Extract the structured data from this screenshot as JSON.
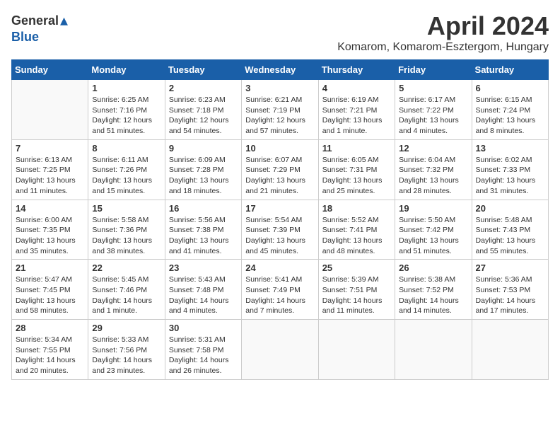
{
  "header": {
    "logo_general": "General",
    "logo_blue": "Blue",
    "month_title": "April 2024",
    "location": "Komarom, Komarom-Esztergom, Hungary"
  },
  "weekdays": [
    "Sunday",
    "Monday",
    "Tuesday",
    "Wednesday",
    "Thursday",
    "Friday",
    "Saturday"
  ],
  "weeks": [
    [
      {
        "day": "",
        "info": ""
      },
      {
        "day": "1",
        "info": "Sunrise: 6:25 AM\nSunset: 7:16 PM\nDaylight: 12 hours\nand 51 minutes."
      },
      {
        "day": "2",
        "info": "Sunrise: 6:23 AM\nSunset: 7:18 PM\nDaylight: 12 hours\nand 54 minutes."
      },
      {
        "day": "3",
        "info": "Sunrise: 6:21 AM\nSunset: 7:19 PM\nDaylight: 12 hours\nand 57 minutes."
      },
      {
        "day": "4",
        "info": "Sunrise: 6:19 AM\nSunset: 7:21 PM\nDaylight: 13 hours\nand 1 minute."
      },
      {
        "day": "5",
        "info": "Sunrise: 6:17 AM\nSunset: 7:22 PM\nDaylight: 13 hours\nand 4 minutes."
      },
      {
        "day": "6",
        "info": "Sunrise: 6:15 AM\nSunset: 7:24 PM\nDaylight: 13 hours\nand 8 minutes."
      }
    ],
    [
      {
        "day": "7",
        "info": "Sunrise: 6:13 AM\nSunset: 7:25 PM\nDaylight: 13 hours\nand 11 minutes."
      },
      {
        "day": "8",
        "info": "Sunrise: 6:11 AM\nSunset: 7:26 PM\nDaylight: 13 hours\nand 15 minutes."
      },
      {
        "day": "9",
        "info": "Sunrise: 6:09 AM\nSunset: 7:28 PM\nDaylight: 13 hours\nand 18 minutes."
      },
      {
        "day": "10",
        "info": "Sunrise: 6:07 AM\nSunset: 7:29 PM\nDaylight: 13 hours\nand 21 minutes."
      },
      {
        "day": "11",
        "info": "Sunrise: 6:05 AM\nSunset: 7:31 PM\nDaylight: 13 hours\nand 25 minutes."
      },
      {
        "day": "12",
        "info": "Sunrise: 6:04 AM\nSunset: 7:32 PM\nDaylight: 13 hours\nand 28 minutes."
      },
      {
        "day": "13",
        "info": "Sunrise: 6:02 AM\nSunset: 7:33 PM\nDaylight: 13 hours\nand 31 minutes."
      }
    ],
    [
      {
        "day": "14",
        "info": "Sunrise: 6:00 AM\nSunset: 7:35 PM\nDaylight: 13 hours\nand 35 minutes."
      },
      {
        "day": "15",
        "info": "Sunrise: 5:58 AM\nSunset: 7:36 PM\nDaylight: 13 hours\nand 38 minutes."
      },
      {
        "day": "16",
        "info": "Sunrise: 5:56 AM\nSunset: 7:38 PM\nDaylight: 13 hours\nand 41 minutes."
      },
      {
        "day": "17",
        "info": "Sunrise: 5:54 AM\nSunset: 7:39 PM\nDaylight: 13 hours\nand 45 minutes."
      },
      {
        "day": "18",
        "info": "Sunrise: 5:52 AM\nSunset: 7:41 PM\nDaylight: 13 hours\nand 48 minutes."
      },
      {
        "day": "19",
        "info": "Sunrise: 5:50 AM\nSunset: 7:42 PM\nDaylight: 13 hours\nand 51 minutes."
      },
      {
        "day": "20",
        "info": "Sunrise: 5:48 AM\nSunset: 7:43 PM\nDaylight: 13 hours\nand 55 minutes."
      }
    ],
    [
      {
        "day": "21",
        "info": "Sunrise: 5:47 AM\nSunset: 7:45 PM\nDaylight: 13 hours\nand 58 minutes."
      },
      {
        "day": "22",
        "info": "Sunrise: 5:45 AM\nSunset: 7:46 PM\nDaylight: 14 hours\nand 1 minute."
      },
      {
        "day": "23",
        "info": "Sunrise: 5:43 AM\nSunset: 7:48 PM\nDaylight: 14 hours\nand 4 minutes."
      },
      {
        "day": "24",
        "info": "Sunrise: 5:41 AM\nSunset: 7:49 PM\nDaylight: 14 hours\nand 7 minutes."
      },
      {
        "day": "25",
        "info": "Sunrise: 5:39 AM\nSunset: 7:51 PM\nDaylight: 14 hours\nand 11 minutes."
      },
      {
        "day": "26",
        "info": "Sunrise: 5:38 AM\nSunset: 7:52 PM\nDaylight: 14 hours\nand 14 minutes."
      },
      {
        "day": "27",
        "info": "Sunrise: 5:36 AM\nSunset: 7:53 PM\nDaylight: 14 hours\nand 17 minutes."
      }
    ],
    [
      {
        "day": "28",
        "info": "Sunrise: 5:34 AM\nSunset: 7:55 PM\nDaylight: 14 hours\nand 20 minutes."
      },
      {
        "day": "29",
        "info": "Sunrise: 5:33 AM\nSunset: 7:56 PM\nDaylight: 14 hours\nand 23 minutes."
      },
      {
        "day": "30",
        "info": "Sunrise: 5:31 AM\nSunset: 7:58 PM\nDaylight: 14 hours\nand 26 minutes."
      },
      {
        "day": "",
        "info": ""
      },
      {
        "day": "",
        "info": ""
      },
      {
        "day": "",
        "info": ""
      },
      {
        "day": "",
        "info": ""
      }
    ]
  ]
}
